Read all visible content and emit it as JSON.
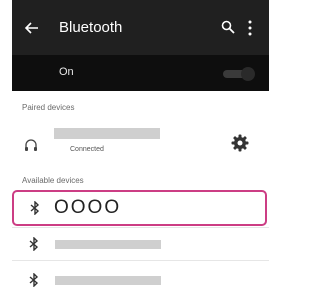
{
  "appbar": {
    "title": "Bluetooth",
    "icons": [
      "back-arrow-icon",
      "search-icon",
      "more-vert-icon"
    ],
    "background": "#202020"
  },
  "toggle": {
    "label": "On",
    "state": "on"
  },
  "paired": {
    "header": "Paired devices",
    "devices": [
      {
        "status": "Connected",
        "icon": "headphones-icon",
        "settings_icon": "gear-icon"
      }
    ]
  },
  "available": {
    "header": "Available devices",
    "devices": [
      {
        "name": "OOOO",
        "icon": "bluetooth-icon",
        "highlighted": true
      },
      {
        "name": "",
        "icon": "bluetooth-icon"
      },
      {
        "name": "",
        "icon": "bluetooth-icon"
      }
    ]
  },
  "colors": {
    "highlight_border": "#cc3d84",
    "placeholder_bar": "#cfcfcf"
  }
}
